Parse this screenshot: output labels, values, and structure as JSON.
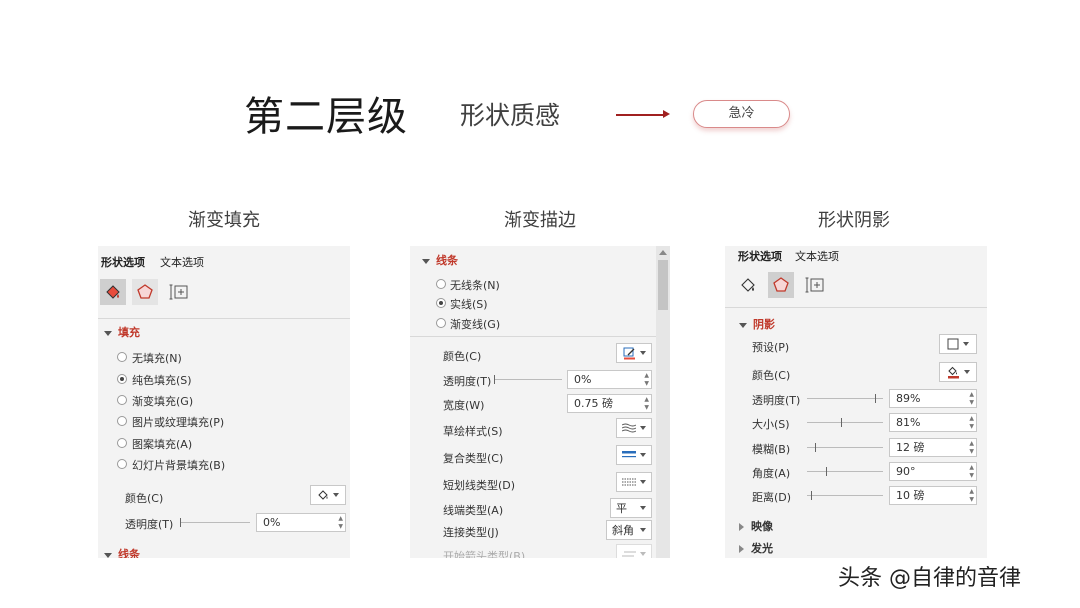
{
  "header": {
    "title": "第二层级",
    "subtitle": "形状质感",
    "tag": "急冷"
  },
  "sections": [
    "渐变填充",
    "渐变描边",
    "形状阴影"
  ],
  "panel_fill": {
    "tabs": [
      "形状选项",
      "文本选项"
    ],
    "group": "填充",
    "options": [
      "无填充(N)",
      "纯色填充(S)",
      "渐变填充(G)",
      "图片或纹理填充(P)",
      "图案填充(A)",
      "幻灯片背景填充(B)"
    ],
    "selected_option": 1,
    "color_label": "颜色(C)",
    "transparency_label": "透明度(T)",
    "transparency_value": "0%",
    "transparency_fraction": 0.0,
    "next_group": "线条"
  },
  "panel_line": {
    "group": "线条",
    "options": [
      "无线条(N)",
      "实线(S)",
      "渐变线(G)"
    ],
    "selected_option": 1,
    "color_label": "颜色(C)",
    "transparency_label": "透明度(T)",
    "transparency_value": "0%",
    "transparency_fraction": 0.0,
    "width_label": "宽度(W)",
    "width_value": "0.75 磅",
    "sketch_label": "草绘样式(S)",
    "compound_label": "复合类型(C)",
    "dash_label": "短划线类型(D)",
    "cap_label": "线端类型(A)",
    "cap_value": "平",
    "join_label": "连接类型(J)",
    "join_value": "斜角",
    "arrow_label": "开始箭头类型(B)"
  },
  "panel_shadow": {
    "tabs": [
      "形状选项",
      "文本选项"
    ],
    "group": "阴影",
    "preset_label": "预设(P)",
    "color_label": "颜色(C)",
    "rows": [
      {
        "label": "透明度(T)",
        "value": "89%",
        "level": 0.89
      },
      {
        "label": "大小(S)",
        "value": "81%",
        "level": 0.45
      },
      {
        "label": "模糊(B)",
        "value": "12 磅",
        "level": 0.1
      },
      {
        "label": "角度(A)",
        "value": "90°",
        "level": 0.25
      },
      {
        "label": "距离(D)",
        "value": "10 磅",
        "level": 0.05
      }
    ],
    "collapsed_groups": [
      "映像",
      "发光"
    ]
  },
  "watermark": "头条 @自律的音律",
  "colors": {
    "accent_red": "#c0392b",
    "arrow": "#a02020",
    "panel_bg": "#f3f3f3"
  }
}
